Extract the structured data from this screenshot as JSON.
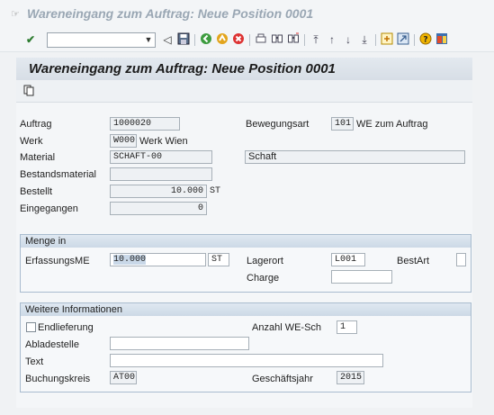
{
  "window": {
    "title": "Wareneingang zum Auftrag: Neue Position 0001"
  },
  "toolbar": {
    "command_field": "",
    "icons": [
      "enter-icon",
      "back-icon",
      "save-icon",
      "exit-icon",
      "cancel-icon",
      "home-icon",
      "print-icon",
      "find-icon",
      "find-next-icon",
      "first-page-icon",
      "previous-page-icon",
      "next-page-icon",
      "last-page-icon",
      "new-session-icon",
      "shortcut-icon",
      "help-icon",
      "layout-icon"
    ]
  },
  "header": {
    "title": "Wareneingang zum Auftrag: Neue Position 0001"
  },
  "form": {
    "auftrag": {
      "label": "Auftrag",
      "value": "1000020"
    },
    "bewegungsart": {
      "label": "Bewegungsart",
      "value": "101",
      "text": "WE zum Auftrag"
    },
    "werk": {
      "label": "Werk",
      "value": "W000",
      "text": "Werk Wien"
    },
    "material": {
      "label": "Material",
      "value": "SCHAFT-00",
      "text": "Schaft"
    },
    "bestandsmaterial": {
      "label": "Bestandsmaterial",
      "value": ""
    },
    "bestellt": {
      "label": "Bestellt",
      "value": "10.000",
      "unit": "ST"
    },
    "eingegangen": {
      "label": "Eingegangen",
      "value": "0"
    }
  },
  "menge": {
    "title": "Menge in",
    "erfassungsme": {
      "label": "ErfassungsME",
      "value": "10.000",
      "unit": "ST"
    },
    "lagerort": {
      "label": "Lagerort",
      "value": "L001"
    },
    "charge": {
      "label": "Charge",
      "value": ""
    },
    "bestart": {
      "label": "BestArt",
      "value": ""
    }
  },
  "weitere": {
    "title": "Weitere Informationen",
    "endlieferung": {
      "label": "Endlieferung",
      "checked": false
    },
    "anzahl": {
      "label": "Anzahl WE-Sch",
      "value": "1"
    },
    "abladestelle": {
      "label": "Abladestelle",
      "value": ""
    },
    "text": {
      "label": "Text",
      "value": ""
    },
    "buchungskreis": {
      "label": "Buchungskreis",
      "value": "AT00"
    },
    "geschaeftsjahr": {
      "label": "Geschäftsjahr",
      "value": "2015"
    }
  },
  "colors": {
    "header_bg": "#d9e0e8",
    "group_border": "#a9bccf",
    "field_border": "#a7b0b8"
  }
}
